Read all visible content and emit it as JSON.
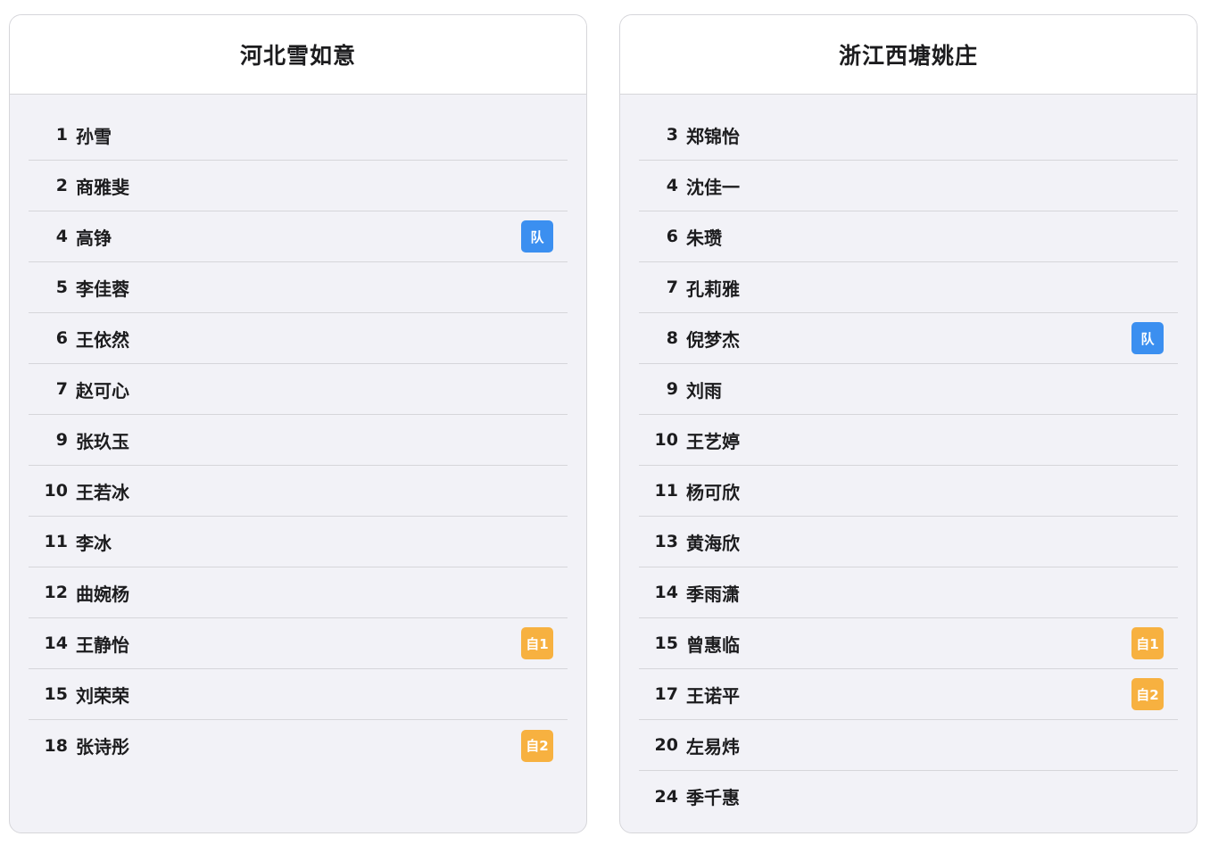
{
  "colors": {
    "captain_badge": "#3b8ff0",
    "wildcard_badge": "#f7b140",
    "card_background": "#f2f2f7",
    "header_background": "#ffffff"
  },
  "teams": [
    {
      "name": "河北雪如意",
      "players": [
        {
          "number": "1",
          "name": "孙雪",
          "badge": ""
        },
        {
          "number": "2",
          "name": "商雅斐",
          "badge": ""
        },
        {
          "number": "4",
          "name": "高铮",
          "badge": "队"
        },
        {
          "number": "5",
          "name": "李佳蓉",
          "badge": ""
        },
        {
          "number": "6",
          "name": "王依然",
          "badge": ""
        },
        {
          "number": "7",
          "name": "赵可心",
          "badge": ""
        },
        {
          "number": "9",
          "name": "张玖玉",
          "badge": ""
        },
        {
          "number": "10",
          "name": "王若冰",
          "badge": ""
        },
        {
          "number": "11",
          "name": "李冰",
          "badge": ""
        },
        {
          "number": "12",
          "name": "曲婉杨",
          "badge": ""
        },
        {
          "number": "14",
          "name": "王静怡",
          "badge": "自1"
        },
        {
          "number": "15",
          "name": "刘荣荣",
          "badge": ""
        },
        {
          "number": "18",
          "name": "张诗彤",
          "badge": "自2"
        }
      ]
    },
    {
      "name": "浙江西塘姚庄",
      "players": [
        {
          "number": "3",
          "name": "郑锦怡",
          "badge": ""
        },
        {
          "number": "4",
          "name": "沈佳一",
          "badge": ""
        },
        {
          "number": "6",
          "name": "朱瓒",
          "badge": ""
        },
        {
          "number": "7",
          "name": "孔莉雅",
          "badge": ""
        },
        {
          "number": "8",
          "name": "倪梦杰",
          "badge": "队"
        },
        {
          "number": "9",
          "name": "刘雨",
          "badge": ""
        },
        {
          "number": "10",
          "name": "王艺婷",
          "badge": ""
        },
        {
          "number": "11",
          "name": "杨可欣",
          "badge": ""
        },
        {
          "number": "13",
          "name": "黄海欣",
          "badge": ""
        },
        {
          "number": "14",
          "name": "季雨潇",
          "badge": ""
        },
        {
          "number": "15",
          "name": "曾惠临",
          "badge": "自1"
        },
        {
          "number": "17",
          "name": "王诺平",
          "badge": "自2"
        },
        {
          "number": "20",
          "name": "左易炜",
          "badge": ""
        },
        {
          "number": "24",
          "name": "季千惠",
          "badge": ""
        }
      ]
    }
  ]
}
